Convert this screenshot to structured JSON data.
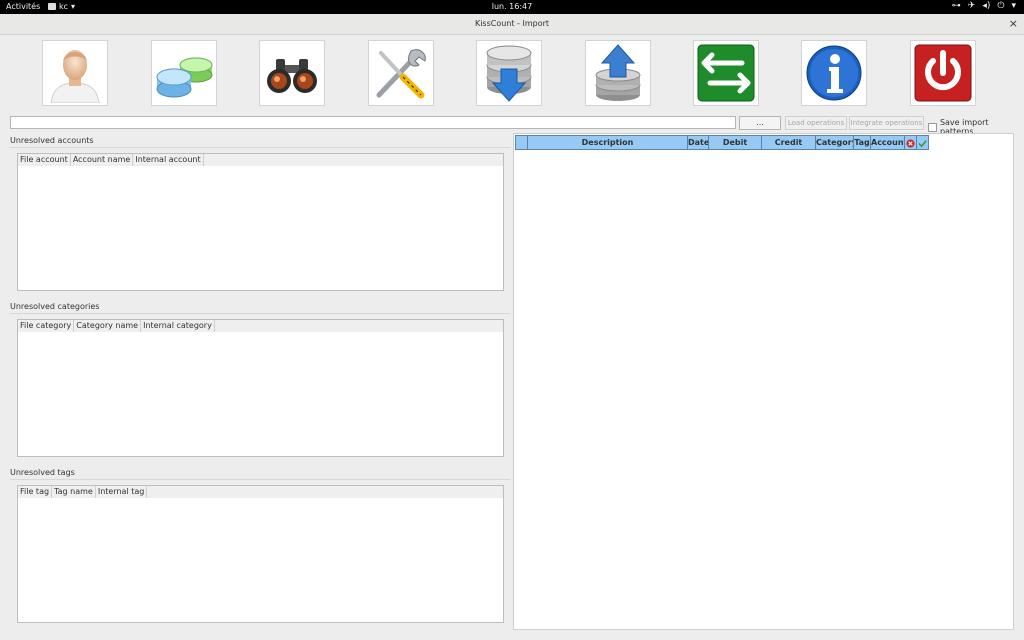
{
  "topbar": {
    "activities": "Activités",
    "app_menu": "kc",
    "clock": "lun. 16:47",
    "tray_icons": [
      "network-icon",
      "airplane-icon",
      "volume-icon",
      "power-icon",
      "chevron-down-icon"
    ]
  },
  "window": {
    "title": "KissCount - Import",
    "close": "×"
  },
  "toolbar": {
    "buttons": [
      {
        "name": "user-icon"
      },
      {
        "name": "accounts-icon"
      },
      {
        "name": "search-binoculars-icon"
      },
      {
        "name": "preferences-tools-icon"
      },
      {
        "name": "import-database-icon"
      },
      {
        "name": "export-database-icon"
      },
      {
        "name": "transfer-arrows-icon"
      },
      {
        "name": "info-icon"
      },
      {
        "name": "quit-power-icon"
      }
    ]
  },
  "import": {
    "path_value": "",
    "browse_label": "...",
    "load_operations": "Load operations",
    "integrate_operations": "Integrate operations",
    "save_patterns_label": "Save import patterns",
    "save_patterns_checked": false
  },
  "unresolved": {
    "accounts": {
      "title": "Unresolved accounts",
      "columns": [
        "File account",
        "Account name",
        "Internal account"
      ]
    },
    "categories": {
      "title": "Unresolved categories",
      "columns": [
        "File category",
        "Category name",
        "Internal category"
      ]
    },
    "tags": {
      "title": "Unresolved tags",
      "columns": [
        "File tag",
        "Tag name",
        "Internal tag"
      ]
    }
  },
  "operations": {
    "columns": [
      "",
      "Description",
      "Date",
      "Debit",
      "Credit",
      "Category",
      "Tag",
      "Account",
      "",
      ""
    ],
    "column_icons": [
      "delete-icon",
      "check-icon"
    ],
    "rows": []
  },
  "colors": {
    "header_blue": "#97c9f5",
    "window_bg": "#ededed"
  }
}
